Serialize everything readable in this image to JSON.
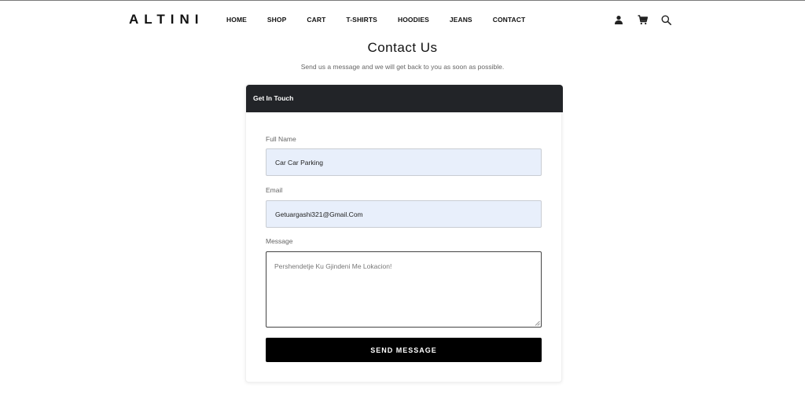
{
  "brand": {
    "logo": "ALTINI"
  },
  "nav": {
    "items": [
      {
        "label": "HOME"
      },
      {
        "label": "SHOP"
      },
      {
        "label": "CART"
      },
      {
        "label": "T-SHIRTS"
      },
      {
        "label": "HOODIES"
      },
      {
        "label": "JEANS"
      },
      {
        "label": "CONTACT"
      }
    ]
  },
  "header_icons": [
    "user-icon",
    "cart-icon",
    "search-icon"
  ],
  "page": {
    "title": "Contact Us",
    "subtitle": "Send us a message and we will get back to you as soon as possible."
  },
  "form": {
    "heading": "Get In Touch",
    "name_label": "Full Name",
    "name_value": "Car Car Parking",
    "email_label": "Email",
    "email_value": "Getuargashi321@Gmail.Com",
    "message_label": "Message",
    "message_placeholder": "Pershendetje Ku Gjindeni Me Lokacion!",
    "submit_label": "SEND MESSAGE"
  },
  "colors": {
    "header_bar": "#222428",
    "field_fill": "#e8effb",
    "button": "#000000"
  }
}
